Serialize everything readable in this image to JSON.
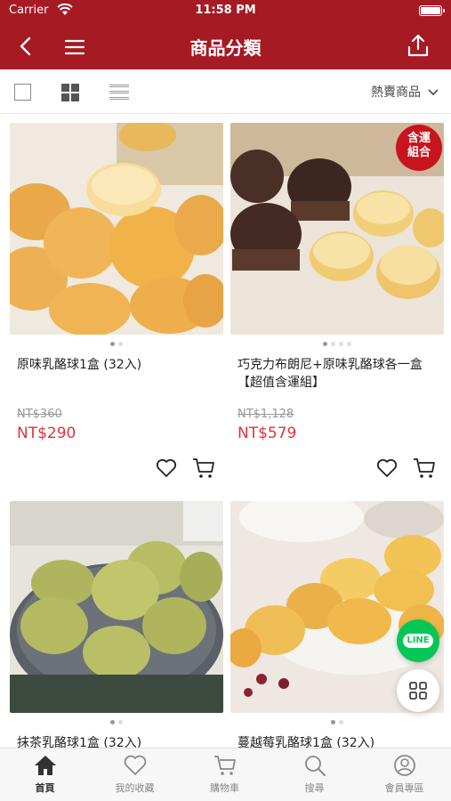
{
  "status_bar": {
    "carrier": "Carrier",
    "time": "11:58 PM"
  },
  "header": {
    "title": "商品分類"
  },
  "filter": {
    "sort_label": "熱賣商品"
  },
  "products": [
    {
      "name": "原味乳酪球1盒 (32入)",
      "old_price": "NT$360",
      "price": "NT$290",
      "image_slides": 2,
      "active_slide": 1
    },
    {
      "name": "巧克力布朗尼+原味乳酪球各一盒【超值含運組】",
      "old_price": "NT$1,128",
      "price": "NT$579",
      "badge": "含運組合",
      "image_slides": 4,
      "active_slide": 1
    },
    {
      "name": "抹茶乳酪球1盒 (32入)",
      "image_slides": 2,
      "active_slide": 1
    },
    {
      "name": "蔓越莓乳酪球1盒 (32入)",
      "image_slides": 2,
      "active_slide": 1
    }
  ],
  "floating": {
    "line_label": "LINE"
  },
  "tabbar": {
    "items": [
      {
        "label": "首頁",
        "icon": "home-icon",
        "active": true
      },
      {
        "label": "我的收藏",
        "icon": "heart-icon",
        "active": false
      },
      {
        "label": "購物車",
        "icon": "cart-icon",
        "active": false
      },
      {
        "label": "搜尋",
        "icon": "search-icon",
        "active": false
      },
      {
        "label": "會員專區",
        "icon": "user-icon",
        "active": false
      }
    ]
  },
  "colors": {
    "brand": "#a51a23",
    "price": "#e0323c",
    "line": "#06c755"
  }
}
